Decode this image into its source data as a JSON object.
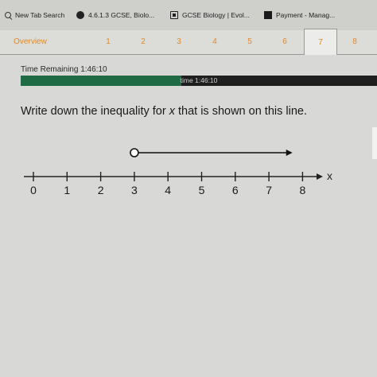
{
  "bookmarks": [
    {
      "label": "New Tab Search",
      "icon": "search-icon"
    },
    {
      "label": "4.6.1.3 GCSE, Biolo...",
      "icon": "globe-icon"
    },
    {
      "label": "GCSE Biology | Evol...",
      "icon": "doc-icon"
    },
    {
      "label": "Payment - Manag...",
      "icon": "square-icon"
    }
  ],
  "tabs": [
    "Overview",
    "1",
    "2",
    "3",
    "4",
    "5",
    "6",
    "7",
    "8"
  ],
  "active_tab": "7",
  "timer": {
    "label": "Time Remaining 1:46:10",
    "bar_text": "time 1:46:10",
    "elapsed_fraction": 0.45
  },
  "question": {
    "prefix": "Write down the inequality for ",
    "variable": "x",
    "suffix": " that is shown on this line."
  },
  "number_line": {
    "ticks": [
      "0",
      "1",
      "2",
      "3",
      "4",
      "5",
      "6",
      "7",
      "8"
    ],
    "axis_label": "x",
    "start_value": 3,
    "circle": "open",
    "direction": "right"
  }
}
